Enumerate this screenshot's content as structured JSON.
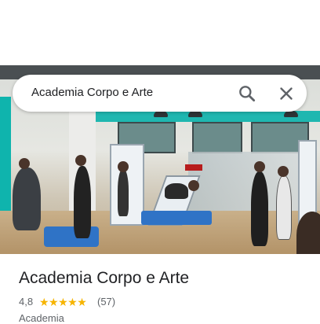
{
  "search": {
    "query": "Academia Corpo e Arte"
  },
  "place": {
    "name": "Academia Corpo e Arte",
    "rating": "4,8",
    "stars": "★★★★★",
    "review_count": "(57)",
    "category": "Academia"
  },
  "icons": {
    "search": "search-icon",
    "close": "close-icon",
    "star": "star-icon"
  },
  "colors": {
    "star": "#f6b400",
    "text_primary": "#202124",
    "text_secondary": "#5f6368"
  }
}
